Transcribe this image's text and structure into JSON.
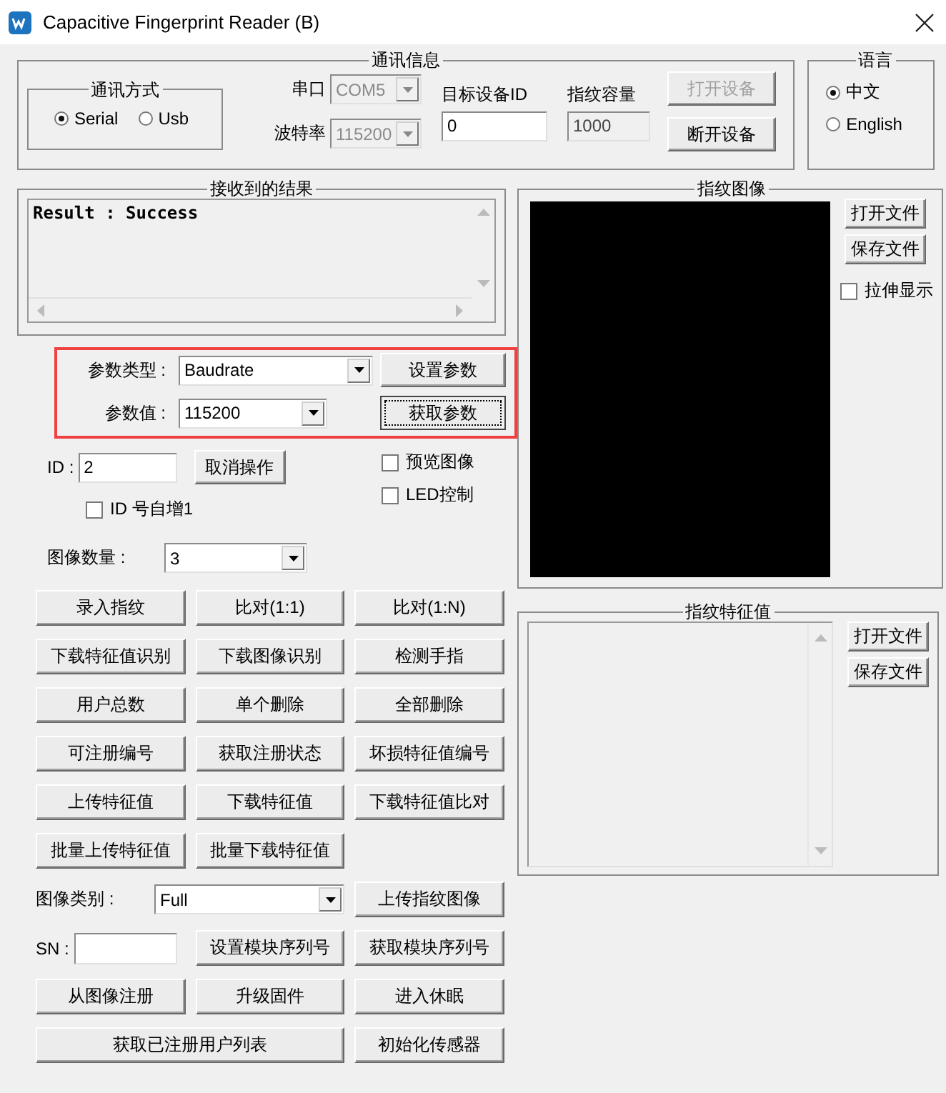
{
  "window": {
    "title": "Capacitive Fingerprint Reader (B)"
  },
  "comm": {
    "title": "通讯信息",
    "mode": {
      "title": "通讯方式",
      "options": [
        {
          "label": "Serial",
          "selected": true
        },
        {
          "label": "Usb",
          "selected": false
        }
      ]
    },
    "port": {
      "label": "串口",
      "value": "COM5",
      "disabled": true
    },
    "baud": {
      "label": "波特率",
      "value": "115200",
      "disabled": true
    },
    "device_id": {
      "label": "目标设备ID",
      "value": "0"
    },
    "capacity": {
      "label": "指纹容量",
      "value": "1000",
      "disabled": true
    },
    "buttons": [
      {
        "label": "打开设备",
        "disabled": true
      },
      {
        "label": "断开设备",
        "disabled": false
      }
    ]
  },
  "language": {
    "title": "语言",
    "options": [
      {
        "label": "中文",
        "selected": true
      },
      {
        "label": "English",
        "selected": false
      }
    ]
  },
  "result": {
    "title": "接收到的结果",
    "text": "Result : Success"
  },
  "params": {
    "rows": [
      {
        "label": "参数类型 :",
        "value": "Baudrate",
        "button": "设置参数",
        "focused": false
      },
      {
        "label": "参数值 :",
        "value": "115200",
        "button": "获取参数",
        "focused": true
      }
    ]
  },
  "id_field": {
    "label": "ID :",
    "value": "2"
  },
  "cancel_button": "取消操作",
  "options": [
    {
      "label": "预览图像",
      "checked": false
    },
    {
      "label": "LED控制",
      "checked": false
    }
  ],
  "auto_increment": {
    "label": "ID 号自增1",
    "checked": false
  },
  "image_count": {
    "label": "图像数量 :",
    "value": "3"
  },
  "action_rows": [
    [
      "录入指纹",
      "比对(1:1)",
      "比对(1:N)"
    ],
    [
      "下载特征值识别",
      "下载图像识别",
      "检测手指"
    ],
    [
      "用户总数",
      "单个删除",
      "全部删除"
    ],
    [
      "可注册编号",
      "获取注册状态",
      "坏损特征值编号"
    ],
    [
      "上传特征值",
      "下载特征值",
      "下载特征值比对"
    ],
    [
      "批量上传特征值",
      "批量下载特征值"
    ]
  ],
  "image_type": {
    "label": "图像类别 :",
    "value": "Full",
    "button": "上传指纹图像"
  },
  "sn": {
    "label": "SN :",
    "buttons": [
      "设置模块序列号",
      "获取模块序列号"
    ]
  },
  "bottom_rows": [
    [
      "从图像注册",
      "升级固件",
      "进入休眠"
    ],
    [
      "获取已注册用户列表",
      "初始化传感器"
    ]
  ],
  "image_panel": {
    "title": "指纹图像",
    "buttons": [
      "打开文件",
      "保存文件"
    ],
    "stretch": {
      "label": "拉伸显示",
      "checked": false
    }
  },
  "feature_panel": {
    "title": "指纹特征值",
    "buttons": [
      "打开文件",
      "保存文件"
    ]
  }
}
